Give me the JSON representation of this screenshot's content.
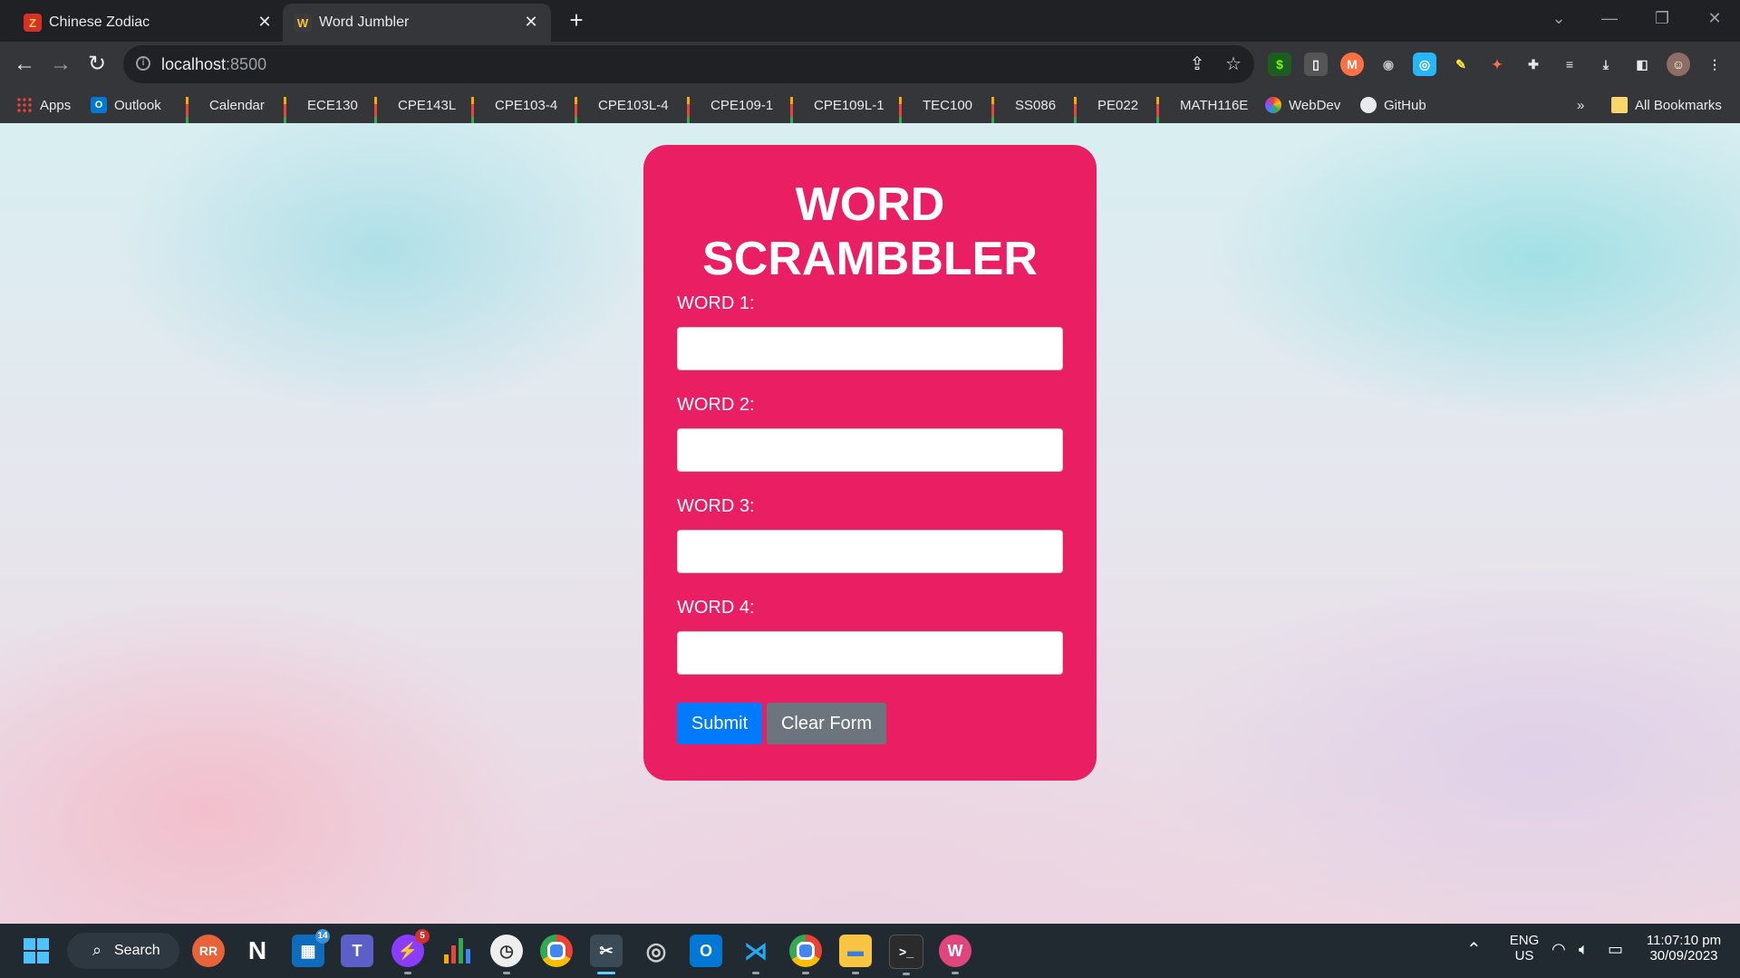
{
  "browser": {
    "tabs": [
      {
        "title": "Chinese Zodiac",
        "favicon": "zodiac-icon",
        "active": false
      },
      {
        "title": "Word Jumbler",
        "favicon": "jumbler-icon",
        "active": true
      }
    ],
    "address": {
      "host": "localhost",
      "port": ":8500"
    },
    "bookmarks": [
      {
        "label": "Apps",
        "icon": "apps-grid-icon"
      },
      {
        "label": "Outlook",
        "icon": "outlook-icon"
      },
      {
        "label": "Calendar",
        "icon": "bar-chart-icon"
      },
      {
        "label": "ECE130",
        "icon": "bar-chart-icon"
      },
      {
        "label": "CPE143L",
        "icon": "bar-chart-icon"
      },
      {
        "label": "CPE103-4",
        "icon": "bar-chart-icon"
      },
      {
        "label": "CPE103L-4",
        "icon": "bar-chart-icon"
      },
      {
        "label": "CPE109-1",
        "icon": "bar-chart-icon"
      },
      {
        "label": "CPE109L-1",
        "icon": "bar-chart-icon"
      },
      {
        "label": "TEC100",
        "icon": "bar-chart-icon"
      },
      {
        "label": "SS086",
        "icon": "bar-chart-icon"
      },
      {
        "label": "PE022",
        "icon": "bar-chart-icon"
      },
      {
        "label": "MATH116E",
        "icon": "bar-chart-icon"
      },
      {
        "label": "WebDev",
        "icon": "webdev-icon"
      },
      {
        "label": "GitHub",
        "icon": "github-icon"
      }
    ],
    "overflow_label": "»",
    "all_bookmarks_label": "All Bookmarks"
  },
  "page": {
    "title": "WORD SCRAMBBLER",
    "fields": [
      {
        "label": "WORD 1:",
        "value": ""
      },
      {
        "label": "WORD 2:",
        "value": ""
      },
      {
        "label": "WORD 3:",
        "value": ""
      },
      {
        "label": "WORD 4:",
        "value": ""
      }
    ],
    "submit_label": "Submit",
    "clear_label": "Clear Form",
    "card_color": "#e91e63",
    "submit_color": "#007bff",
    "clear_color": "#6c757d"
  },
  "taskbar": {
    "search_label": "Search",
    "badges": {
      "mail": "14",
      "messenger": "5"
    },
    "language": {
      "line1": "ENG",
      "line2": "US"
    },
    "clock": {
      "time": "11:07:10 pm",
      "date": "30/09/2023"
    }
  }
}
